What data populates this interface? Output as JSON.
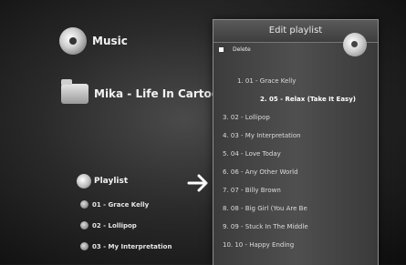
{
  "menu": {
    "music_label": "Music",
    "album_label": "Mika - Life In Cartoon Moti"
  },
  "playlist": {
    "title": "Playlist",
    "tracks": [
      "01 - Grace Kelly",
      "02 - Lollipop",
      "03 - My Interpretation"
    ]
  },
  "edit_panel": {
    "title": "Edit playlist",
    "delete_label": "Delete",
    "items": [
      "1. 01 - Grace Kelly",
      "2. 05 - Relax (Take It Easy)",
      "3. 02 - Lollipop",
      "4. 03 - My Interpretation",
      "5. 04 - Love Today",
      "6. 06 - Any Other World",
      "7. 07 - Billy Brown",
      "8. 08 - Big Girl (You Are Be",
      "9. 09 - Stuck In The Middle",
      "10. 10 - Happy Ending"
    ],
    "selected_index": 2
  },
  "colors": {
    "background": "#2a2a2a",
    "panel": "#474747",
    "text": "#f2f2f2",
    "selected_text": "#ffffff"
  }
}
